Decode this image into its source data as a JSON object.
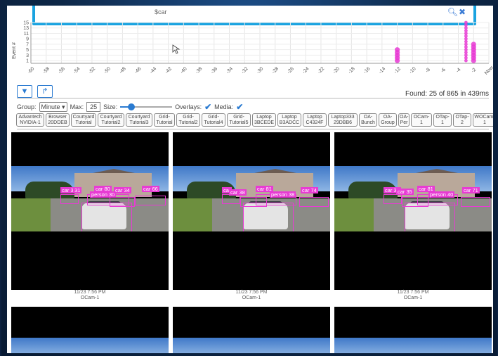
{
  "search": {
    "query": "$car"
  },
  "chart": {
    "ylabel": "Event #",
    "yticks": [
      "15",
      "13",
      "11",
      "9",
      "7",
      "5",
      "3",
      "1"
    ],
    "xticks": [
      "-60",
      "-58",
      "-56",
      "-54",
      "-52",
      "-50",
      "-48",
      "-46",
      "-44",
      "-42",
      "-40",
      "-38",
      "-36",
      "-34",
      "-32",
      "-30",
      "-28",
      "-26",
      "-24",
      "-22",
      "-20",
      "-18",
      "-16",
      "-14",
      "-12",
      "-10",
      "-8",
      "-6",
      "-4",
      "-2",
      "Now"
    ],
    "accent_color": "#e83bd4"
  },
  "chart_data": {
    "type": "scatter",
    "xlabel": "",
    "ylabel": "Event #",
    "ylim": [
      0,
      15
    ],
    "xlim": [
      -60,
      0
    ],
    "series": [
      {
        "x": [
          -12,
          -12,
          -12,
          -12,
          -12
        ],
        "y": [
          1,
          2,
          3,
          4,
          5
        ]
      },
      {
        "x": [
          -3,
          -3,
          -3,
          -3,
          -3,
          -3,
          -3,
          -3,
          -3,
          -3,
          -3,
          -3,
          -3,
          -3,
          -3
        ],
        "y": [
          1,
          2,
          3,
          4,
          5,
          6,
          7,
          8,
          9,
          10,
          11,
          12,
          13,
          14,
          15
        ]
      },
      {
        "x": [
          -2,
          -2,
          -2,
          -2,
          -2,
          -2,
          -2
        ],
        "y": [
          1,
          2,
          3,
          4,
          5,
          6,
          7
        ]
      }
    ]
  },
  "toolbar": {
    "found_text": "Found: 25 of 865 in 439ms",
    "group_label": "Group:",
    "group_value": "Minute",
    "max_label": "Max:",
    "max_value": "25",
    "size_label": "Size:",
    "size_level": 0.22,
    "overlays_label": "Overlays:",
    "media_label": "Media:"
  },
  "cameras": [
    [
      "Advantech",
      "NVIDIA-1"
    ],
    [
      "Browser",
      "20DDEB"
    ],
    [
      "Courtyard",
      "Tutorial"
    ],
    [
      "Courtyard",
      "Tutorial2"
    ],
    [
      "Courtyard",
      "Tutorial3"
    ],
    [
      "Grid-",
      "Tutorial"
    ],
    [
      "Grid-",
      "Tutorial2"
    ],
    [
      "Grid-",
      "Tutorial4"
    ],
    [
      "Grid-",
      "Tutorial5"
    ],
    [
      "Laptop",
      "3BCEDE"
    ],
    [
      "Laptop",
      "B3ADCC"
    ],
    [
      "Laptop",
      "C4324F"
    ],
    [
      "Laptop333",
      "29DBB6"
    ],
    [
      "OA-",
      "Bunch"
    ],
    [
      "OA-",
      "Group"
    ],
    [
      "OA-",
      "Per"
    ],
    [
      "OCam-",
      "1"
    ],
    [
      "OTap-",
      "1"
    ],
    [
      "OTap-",
      "2"
    ],
    [
      "WOCam-",
      "1"
    ]
  ],
  "results": [
    {
      "time": "11/23 7:56 PM",
      "camera": "OCam-1",
      "labels": [
        "car 30",
        "31",
        "car 80",
        "person 30",
        "car 34",
        "car 66"
      ]
    },
    {
      "time": "11/23 7:56 PM",
      "camera": "OCam-1",
      "labels": [
        "car",
        "car 38",
        "car 81",
        "person 38",
        "car 74"
      ]
    },
    {
      "time": "11/23 7:56 PM",
      "camera": "OCam-1",
      "labels": [
        "car 34",
        "car 35",
        "car 81",
        "person 40",
        "car 71"
      ]
    }
  ]
}
